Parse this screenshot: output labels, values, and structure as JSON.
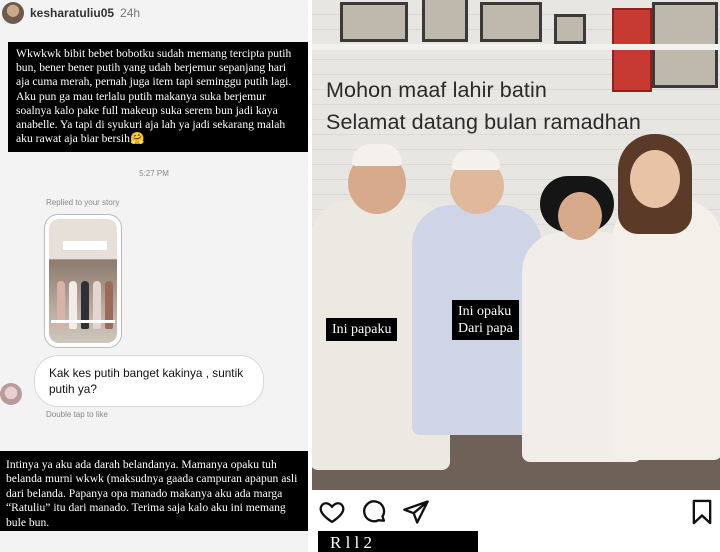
{
  "story": {
    "username": "kesharatuliu05",
    "time_ago": "24h",
    "caption_top": "Wkwkwk bibit bebet bobotku sudah memang tercipta putih bun, bener bener putih yang udah berjemur sepanjang hari aja cuma merah, pernah juga item tapi seminggu putih lagi. Aku pun ga mau terlalu putih makanya suka berjemur soalnya kalo pake full makeup suka serem bun jadi kaya anabelle. Ya tapi di syukuri aja lah ya jadi sekarang malah aku rawat aja biar bersih🤗",
    "caption_bottom": "Intinya ya aku ada darah belandanya. Mamanya opaku tuh belanda murni wkwk (maksudnya gaada campuran apapun asli dari belanda. Papanya opa manado makanya aku ada marga “Ratuliu” itu dari manado. Terima saja kalo aku ini memang bule bun."
  },
  "dm": {
    "timestamp": "5:27 PM",
    "replied_label": "Replied to your story",
    "message": "Kak kes putih banget kakinya , suntik putih ya?",
    "double_tap": "Double tap to like"
  },
  "post": {
    "headline_1": "Mohon maaf lahir batin",
    "headline_2": "Selamat datang bulan ramadhan",
    "label_papa": "Ini papaku",
    "label_opa_1": "Ini opaku",
    "label_opa_2": "Dari papa",
    "next_caption_peek": "R    l     l       2",
    "icons": [
      "heart-icon",
      "comment-icon",
      "share-icon",
      "bookmark-icon"
    ]
  },
  "colors": {
    "caption_bg": "#000000",
    "bubble_bg": "#ffffff",
    "panel_bg": "#f3f3f3"
  }
}
